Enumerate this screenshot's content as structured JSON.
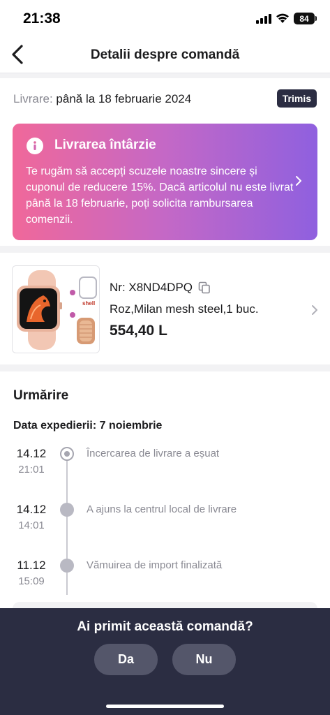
{
  "status_bar": {
    "time": "21:38",
    "battery": "84"
  },
  "header": {
    "title": "Detalii despre comandă"
  },
  "delivery": {
    "label": "Livrare:",
    "value": "până la 18 februarie 2024",
    "badge": "Trimis"
  },
  "alert": {
    "title": "Livrarea întârzie",
    "text": "Te rugăm să accepți scuzele noastre sincere și cuponul de reducere 15%. Dacă articolul nu este livrat până la 18 februarie, poți solicita rambursarea comenzii."
  },
  "product": {
    "order_number": "Nr: X8ND4DPQ",
    "variant": "Roz,Milan mesh steel,1 buc.",
    "price": "554,40 L",
    "image_caption": "shell"
  },
  "tracking": {
    "title": "Urmărire",
    "ship_date": "Data expedierii: 7 noiembrie",
    "events": [
      {
        "date": "14.12",
        "time": "21:01",
        "text": "Încercarea de livrare a eșuat"
      },
      {
        "date": "14.12",
        "time": "14:01",
        "text": "A ajuns la centrul local de livrare"
      },
      {
        "date": "11.12",
        "time": "15:09",
        "text": "Vămuirea de import finalizată"
      }
    ]
  },
  "confirm": {
    "question": "Ai primit această comandă?",
    "yes": "Da",
    "no": "Nu"
  },
  "colors": {
    "badge_bg": "#2b2d42",
    "alert_gradient_start": "#f0689a",
    "alert_gradient_end": "#8f60df",
    "bottom_panel": "#2b2d42"
  }
}
